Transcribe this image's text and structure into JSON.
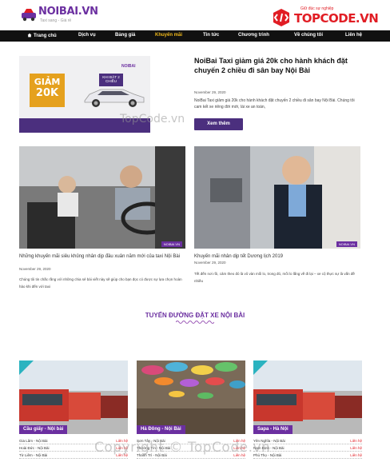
{
  "header": {
    "logo_text": "NOIBAI.VN",
    "logo_sub": "Taxi sang - Giá rẻ",
    "tc_text": "TOPCODE.VN",
    "tc_sub": "Giữ đúc sự nghiệp"
  },
  "nav": {
    "items": [
      {
        "label": "Trang chủ"
      },
      {
        "label": "Dịch vụ"
      },
      {
        "label": "Bảng giá"
      },
      {
        "label": "Khuyến mãi"
      },
      {
        "label": "Tin tức"
      },
      {
        "label": "Chương trình"
      },
      {
        "label": "Về chúng tôi"
      },
      {
        "label": "Liên hệ"
      }
    ],
    "active_index": 3
  },
  "featured": {
    "promo_line1": "GIẢM",
    "promo_line2": "20K",
    "promo_badge": "KHI ĐẶT 2 CHIỀU",
    "brand": "NOIBAI",
    "title": "NoiBai Taxi giảm giá 20k cho hành khách đặt chuyến 2 chiều đi sân bay Nội Bài",
    "date": "November 29, 2020",
    "desc": "NoiBai Taxi giảm giá 20k cho hành khách đặt chuyến 2 chiều đi sân bay Nội Bài. Chúng tôi cam kết xe riêng đời mới, lái xe an toàn,",
    "button": "Xem thêm"
  },
  "watermark_mid": "TopCode.vn",
  "articles": [
    {
      "title": "Những khuyến mãi siêu khủng nhân dịp đầu xuân năm mới của taxi Nội Bài",
      "date": "November 29, 2020",
      "desc": "Chúng tôi tin chắc rằng với những chia sẻ bài viết này sẽ giúp cho bạn đọc có được sự lựa chọn hoàn hảo khi đến với taxi",
      "wm": "NOIBAI.VN"
    },
    {
      "title": "Khuyến mãi nhân dịp tết Dương lịch 2019",
      "date": "November 29, 2020",
      "desc": "Tết đến nơi rồi, cảm theo đó là vô vàn mối lo, trong đó, mối lo lắng về đi lại – xe cộ thực sự là vấn đề nhiều",
      "wm": "NOIBAI.VN"
    }
  ],
  "routes_section": {
    "title": "TUYẾN ĐƯỜNG ĐẶT XE NỘI BÀI"
  },
  "routes": [
    {
      "label": "Cầu giấy - Nội bài",
      "rows": [
        {
          "name": "Gia Lâm - Nội Bài",
          "action": "Liên hệ"
        },
        {
          "name": "Hoài Đức - Nội Bài",
          "action": "Liên hệ"
        },
        {
          "name": "Từ Liêm - Nội Bài",
          "action": "Liên hệ"
        }
      ]
    },
    {
      "label": "Hà Đông - Nội Bài",
      "rows": [
        {
          "name": "Sơn Tây - Nội Bài",
          "action": "Liên hệ"
        },
        {
          "name": "Thường Tín - Nội Bài",
          "action": "Liên hệ"
        },
        {
          "name": "Thanh Trì - Nội Bài",
          "action": "Liên hệ"
        }
      ]
    },
    {
      "label": "Sapa - Hà Nội",
      "rows": [
        {
          "name": "Yên Nghĩa - Nội Bài",
          "action": "Liên hệ"
        },
        {
          "name": "Nam Định - Nội Bài",
          "action": "Liên hệ"
        },
        {
          "name": "Phú Thọ - Nội Bài",
          "action": "Liên hệ"
        }
      ]
    }
  ],
  "copyright": "Copyright © TopCode.vn",
  "colors": {
    "brand_purple": "#6b2fa0",
    "button_purple": "#4b2f7e",
    "nav_bg": "#111111",
    "active_nav": "#f0b81a",
    "topcode_red": "#e11d24",
    "promo_orange": "#e5a11e"
  }
}
